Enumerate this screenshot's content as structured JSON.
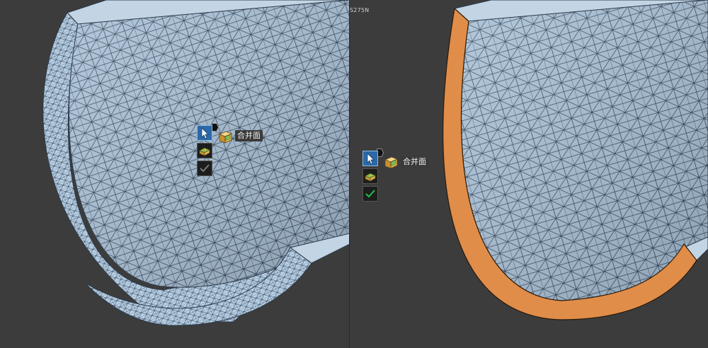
{
  "viewports": {
    "right_label": "S275N"
  },
  "toolsets": [
    {
      "id": "left",
      "select_icon": "cursor-arrow-icon",
      "merge_icon": "merge-faces-icon",
      "merge_label": "合并面",
      "secondary_icon": "face-body-icon",
      "confirm_icon": "checkmark-icon",
      "confirm_state": "disabled"
    },
    {
      "id": "right",
      "select_icon": "cursor-arrow-icon",
      "merge_icon": "merge-faces-icon",
      "merge_label": "合并面",
      "secondary_icon": "face-body-icon",
      "confirm_icon": "checkmark-icon",
      "confirm_state": "enabled"
    }
  ],
  "colors": {
    "background": "#3c3c3c",
    "mesh_face": "#a9c0d6",
    "mesh_edge": "#2b3a4c",
    "selected_face": "#e08d4a",
    "select_button": "#2b69a8",
    "check_enabled": "#22c04a",
    "check_disabled": "#7a7a7a"
  }
}
